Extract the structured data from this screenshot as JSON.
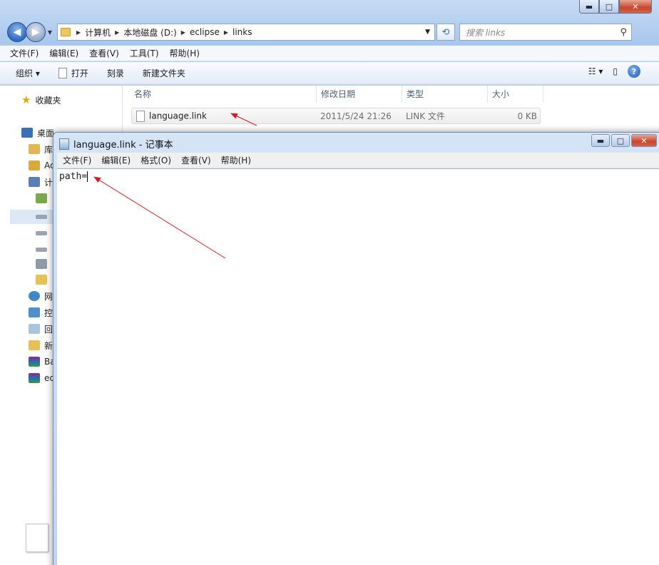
{
  "explorer": {
    "window_buttons": {
      "minimize": "▬",
      "maximize": "□",
      "close": "✕"
    },
    "breadcrumbs": [
      "计算机",
      "本地磁盘 (D:)",
      "eclipse",
      "links"
    ],
    "search_placeholder": "搜索 links",
    "menu": [
      "文件(F)",
      "编辑(E)",
      "查看(V)",
      "工具(T)",
      "帮助(H)"
    ],
    "toolbar": {
      "organize": "组织 ▾",
      "open": "打开",
      "burn": "刻录",
      "new_folder": "新建文件夹"
    },
    "sidebar": {
      "favorites": "收藏夹",
      "items": [
        "桌面",
        "库",
        "Ac",
        "计",
        "",
        "",
        "",
        "",
        "",
        "网",
        "控",
        "回",
        "新",
        "Ba",
        "ec"
      ]
    },
    "columns": {
      "name": "名称",
      "date": "修改日期",
      "type": "类型",
      "size": "大小"
    },
    "files": [
      {
        "name": "language.link",
        "date": "2011/5/24 21:26",
        "type": "LINK 文件",
        "size": "0 KB"
      }
    ]
  },
  "notepad": {
    "title": "language.link - 记事本",
    "menu": [
      "文件(F)",
      "编辑(E)",
      "格式(O)",
      "查看(V)",
      "帮助(H)"
    ],
    "content": "path="
  },
  "annotation_color": "#d42020"
}
